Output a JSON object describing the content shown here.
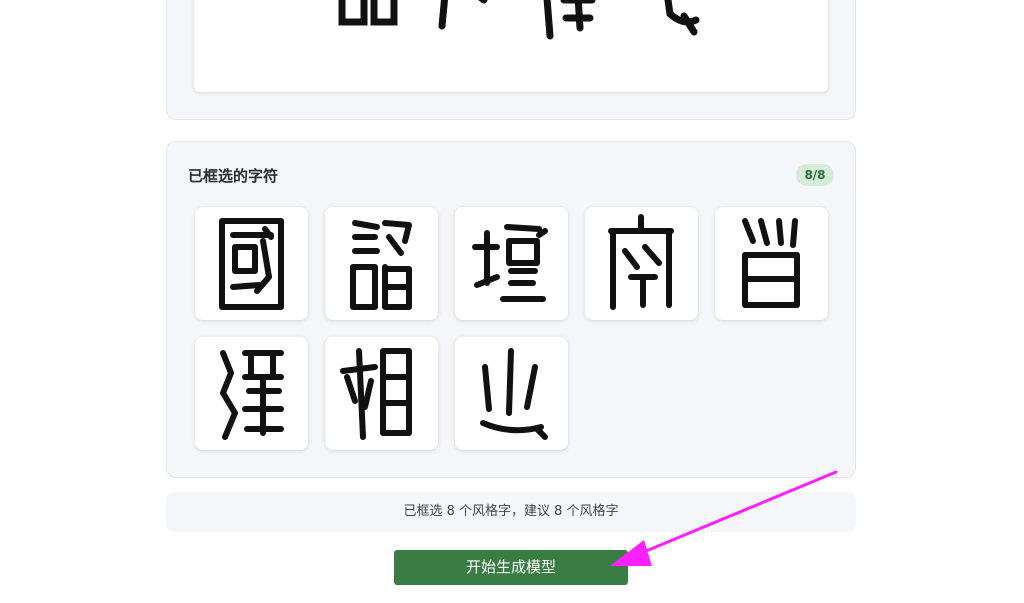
{
  "source_preview": {
    "image_name": "calligraphy-source-image"
  },
  "selected_panel": {
    "title": "已框选的字符",
    "count_badge": "8/8",
    "characters": [
      {
        "glyph_name": "guo-seal-glyph"
      },
      {
        "glyph_name": "shao-seal-glyph"
      },
      {
        "glyph_name": "tan-seal-glyph"
      },
      {
        "glyph_name": "kong-seal-glyph"
      },
      {
        "glyph_name": "gu-seal-glyph"
      },
      {
        "glyph_name": "han-seal-glyph"
      },
      {
        "glyph_name": "xiang-seal-glyph"
      },
      {
        "glyph_name": "zhi-seal-glyph"
      }
    ]
  },
  "info_text": "已框选 8 个风格字，建议 8 个风格字",
  "actions": {
    "generate_label": "开始生成模型"
  },
  "colors": {
    "button": "#3a7d44",
    "badge_bg": "#d4ecd8",
    "badge_text": "#2e6b3a",
    "panel_bg": "#f5f6fa",
    "annotation": "#ff1fff"
  }
}
